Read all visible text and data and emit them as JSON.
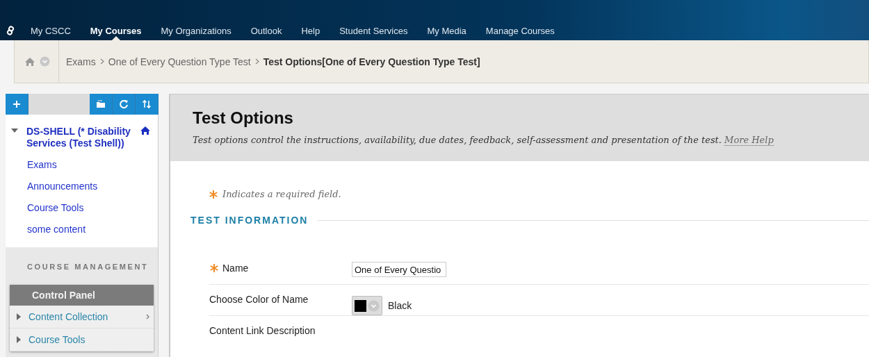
{
  "top_nav": [
    {
      "label": "My CSCC",
      "selected": false
    },
    {
      "label": "My Courses",
      "selected": true
    },
    {
      "label": "My Organizations",
      "selected": false
    },
    {
      "label": "Outlook",
      "selected": false
    },
    {
      "label": "Help",
      "selected": false
    },
    {
      "label": "Student Services",
      "selected": false
    },
    {
      "label": "My Media",
      "selected": false
    },
    {
      "label": "Manage Courses",
      "selected": false
    }
  ],
  "breadcrumbs": [
    "Exams",
    "One of Every Question Type Test",
    "Test Options[One of Every Question Type Test]"
  ],
  "sidebar": {
    "course": {
      "title": "DS-SHELL (* Disability Services (Test Shell))",
      "expanded": true,
      "items": [
        "Exams",
        "Announcements",
        "Course Tools",
        "some content"
      ]
    },
    "section_heading": "COURSE MANAGEMENT",
    "control_panel": {
      "title": "Control Panel",
      "items": [
        {
          "label": "Content Collection",
          "expanded": false,
          "has_submenu": true
        },
        {
          "label": "Course Tools",
          "expanded": false,
          "has_submenu": false
        }
      ]
    }
  },
  "main": {
    "title": "Test Options",
    "description": "Test options control the instructions, availability, due dates, feedback, self-assessment and presentation of the test.",
    "help_link": "More Help",
    "required_note": "Indicates a required field.",
    "section_heading": "TEST INFORMATION",
    "fields": [
      {
        "kind": "text",
        "label": "Name",
        "required": true,
        "value": "One of Every Questio"
      },
      {
        "kind": "color",
        "label": "Choose Color of Name",
        "required": false,
        "color": "#000000",
        "value": "Black"
      },
      {
        "kind": "label",
        "label": "Content Link Description",
        "required": false
      }
    ]
  }
}
